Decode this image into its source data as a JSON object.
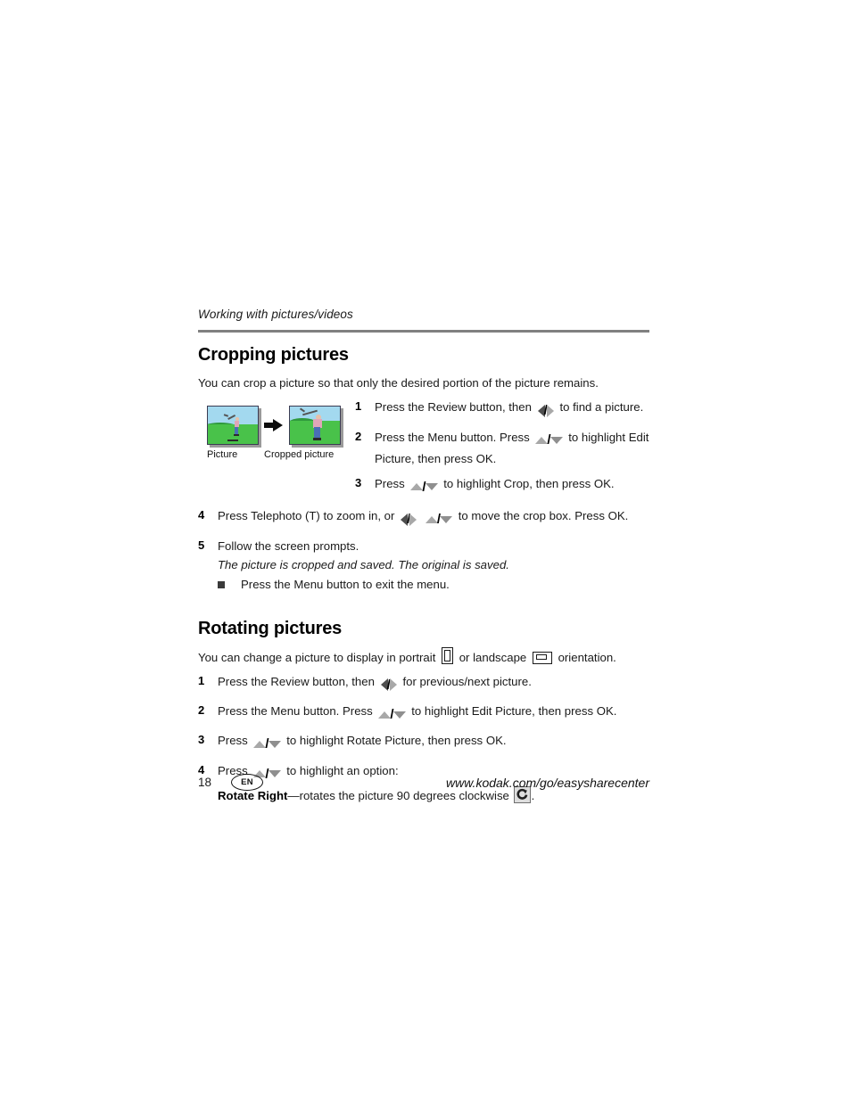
{
  "running_header": "Working with pictures/videos",
  "cropping": {
    "title": "Cropping pictures",
    "intro": "You can crop a picture so that only the desired portion of the picture remains.",
    "figure": {
      "caption_before": "Picture",
      "caption_after": "Cropped picture",
      "arrow_icon": "arrow-right-icon"
    },
    "steps": [
      {
        "num": "1",
        "text_a": "Press the Review button, then",
        "keys": "left-right-keys",
        "text_b": "to find a picture."
      },
      {
        "num": "2",
        "text_a": "Press the Menu button. Press",
        "keys": "up-down-keys",
        "text_b": "to highlight Edit Picture, then press OK."
      },
      {
        "num": "3",
        "text_a": "Press",
        "keys": "up-down-keys",
        "text_b": "to highlight Crop, then press OK."
      },
      {
        "num": "4",
        "text_a": "Press Telephoto (T) to zoom in, or",
        "keys": "left-right-keys",
        "keys2": "up-down-keys",
        "text_b": "to move the crop box. Press OK."
      },
      {
        "num": "5",
        "text_a": "Follow the screen prompts.",
        "keys": "",
        "text_b": ""
      }
    ],
    "note": "The picture is cropped and saved. The original is saved.",
    "bullet": "Press the Menu button to exit the menu."
  },
  "rotating": {
    "title": "Rotating pictures",
    "intro_a": "You can change a picture to display in portrait",
    "intro_b": "or landscape",
    "intro_c": "orientation.",
    "steps": [
      {
        "num": "1",
        "text_a": "Press the Review button, then",
        "keys": "left-right-keys",
        "text_b": "for previous/next picture."
      },
      {
        "num": "2",
        "text_a": "Press the Menu button. Press",
        "keys": "up-down-keys",
        "text_b": "to highlight Edit Picture, then press OK."
      },
      {
        "num": "3",
        "text_a": "Press",
        "keys": "up-down-keys",
        "text_b": "to highlight Rotate Picture, then press OK."
      },
      {
        "num": "4",
        "text_a": "Press",
        "keys": "up-down-keys",
        "text_b": "to highlight an option:"
      }
    ],
    "option_label": "Rotate Right",
    "option_text_a": "—rotates the picture 90 degrees clockwise",
    "option_text_b": "."
  },
  "footer": {
    "page_number": "18",
    "language_badge": "EN",
    "url": "www.kodak.com/go/easysharecenter"
  },
  "colors": {
    "rule": "#808080",
    "text": "#1a1a1a",
    "sky": "#a3d9ef",
    "grass": "#49c24a"
  }
}
